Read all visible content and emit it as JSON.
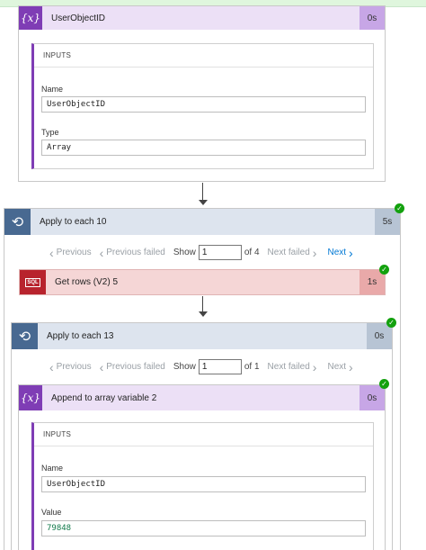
{
  "top_action": {
    "title": "UserObjectID",
    "duration": "0s",
    "inputs_header": "INPUTS",
    "field1_label": "Name",
    "field1_value": "UserObjectID",
    "field2_label": "Type",
    "field2_value": "Array"
  },
  "loop_outer": {
    "title": "Apply to each 10",
    "duration": "5s",
    "pager": {
      "previous": "Previous",
      "previous_failed": "Previous failed",
      "show": "Show",
      "page": "1",
      "of": "of 4",
      "next_failed": "Next failed",
      "next": "Next"
    }
  },
  "sql_action": {
    "icon_text": "SQL",
    "title": "Get rows (V2) 5",
    "duration": "1s"
  },
  "loop_inner": {
    "title": "Apply to each 13",
    "duration": "0s",
    "pager": {
      "previous": "Previous",
      "previous_failed": "Previous failed",
      "show": "Show",
      "page": "1",
      "of": "of 1",
      "next_failed": "Next failed",
      "next": "Next"
    }
  },
  "append_action": {
    "title": "Append to array variable 2",
    "duration": "0s",
    "inputs_header": "INPUTS",
    "field1_label": "Name",
    "field1_value": "UserObjectID",
    "field2_label": "Value",
    "field2_value": "79848"
  },
  "icons": {
    "variable": "{x}",
    "check": "✓",
    "chev_left": "‹",
    "chev_right": "›"
  }
}
